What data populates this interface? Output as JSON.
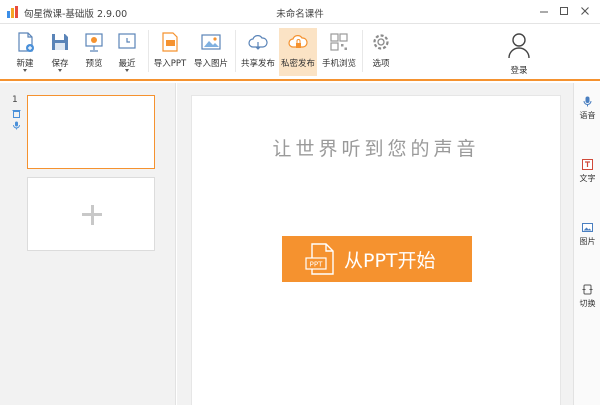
{
  "titlebar": {
    "app_title": "匈星微课-基础版 2.9.00",
    "window_title": "未命名课件",
    "icons": [
      "app-logo-icon",
      "minimize-icon",
      "maximize-icon",
      "close-icon"
    ]
  },
  "toolbar": {
    "items": [
      {
        "id": "new",
        "label": "新建",
        "icon": "new-file-icon",
        "has_menu": true
      },
      {
        "id": "save",
        "label": "保存",
        "icon": "save-icon",
        "has_menu": true
      },
      {
        "id": "preview",
        "label": "预览",
        "icon": "preview-icon",
        "has_menu": false
      },
      {
        "id": "recent",
        "label": "最近",
        "icon": "recent-icon",
        "has_menu": true
      },
      {
        "id": "import_ppt",
        "label": "导入PPT",
        "icon": "import-ppt-icon",
        "has_menu": false
      },
      {
        "id": "import_image",
        "label": "导入图片",
        "icon": "import-image-icon",
        "has_menu": false
      },
      {
        "id": "share_publish",
        "label": "共享发布",
        "icon": "cloud-share-icon",
        "has_menu": false
      },
      {
        "id": "private_publish",
        "label": "私密发布",
        "icon": "cloud-lock-icon",
        "has_menu": false,
        "active": true
      },
      {
        "id": "mobile_browse",
        "label": "手机浏览",
        "icon": "qr-code-icon",
        "has_menu": false
      },
      {
        "id": "options",
        "label": "选项",
        "icon": "gear-icon",
        "has_menu": false
      }
    ],
    "login_label": "登录"
  },
  "slides": {
    "items": [
      {
        "number": "1"
      }
    ]
  },
  "stage": {
    "slogan": "让世界听到您的声音",
    "start_button_label": "从PPT开始",
    "ppt_icon_text": "PPT"
  },
  "rightbar": {
    "items": [
      {
        "label": "语音",
        "icon": "microphone-icon"
      },
      {
        "label": "文字",
        "icon": "text-icon"
      },
      {
        "label": "图片",
        "icon": "image-icon"
      },
      {
        "label": "切换",
        "icon": "transition-icon"
      }
    ]
  },
  "colors": {
    "accent": "#f5922f",
    "active_tab_bg": "#fbe3c5",
    "panel_bg": "#f2f2f2",
    "slogan_text": "#9a9a9a"
  }
}
